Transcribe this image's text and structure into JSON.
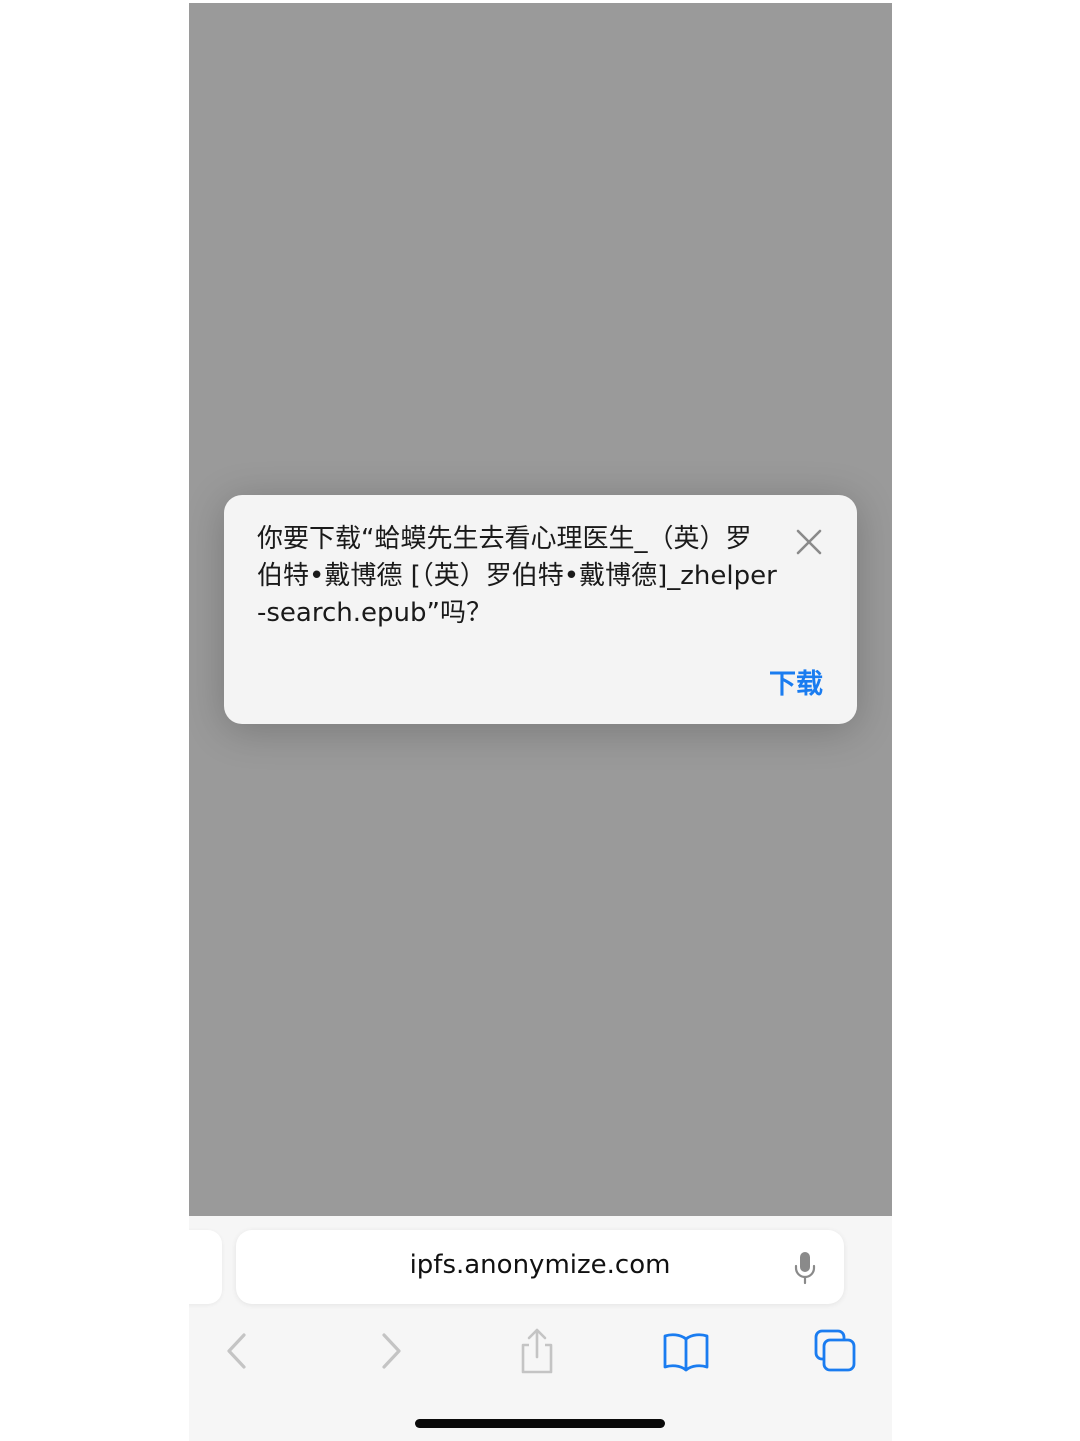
{
  "dialog": {
    "message": "你要下载“蛤蟆先生去看心理医生_（英）罗伯特•戴博德 [（英）罗伯特•戴博德]_zhelper-search.epub”吗？",
    "download_label": "下载"
  },
  "address_bar": {
    "url": "ipfs.anonymize.com"
  },
  "icons": {
    "close": "close-icon",
    "mic": "microphone-icon",
    "back": "chevron-left-icon",
    "forward": "chevron-right-icon",
    "share": "share-icon",
    "bookmarks": "book-icon",
    "tabs": "tabs-icon"
  },
  "colors": {
    "accent": "#1a7cf0",
    "overlay": "#9a9a9a",
    "disabled": "#c4c4c4"
  }
}
